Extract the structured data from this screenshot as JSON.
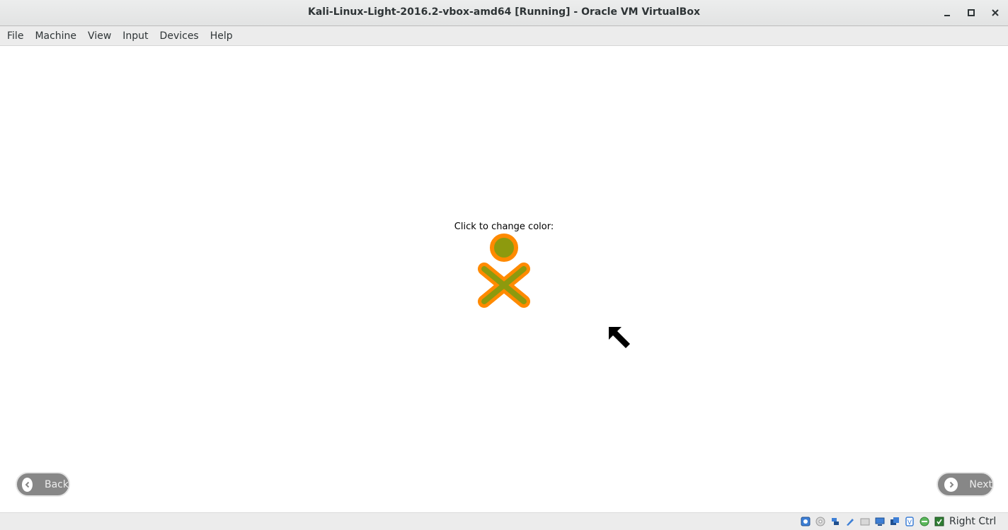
{
  "window": {
    "title": "Kali-Linux-Light-2016.2-vbox-amd64 [Running] - Oracle VM VirtualBox"
  },
  "menu": {
    "items": [
      {
        "label": "File"
      },
      {
        "label": "Machine"
      },
      {
        "label": "View"
      },
      {
        "label": "Input"
      },
      {
        "label": "Devices"
      },
      {
        "label": "Help"
      }
    ]
  },
  "guest": {
    "prompt": "Click to change color:",
    "xo_icon": {
      "fill": "#8d9a0e",
      "stroke": "#ff8a00",
      "icon": "xo-person-icon"
    },
    "back_label": "Back",
    "next_label": "Next"
  },
  "statusbar": {
    "host_key": "Right Ctrl",
    "icons": [
      "hard-disk-icon",
      "optical-drive-icon",
      "usb-icon",
      "shared-folders-icon",
      "display-icon",
      "network-icon",
      "video-capture-icon",
      "mouse-integration-icon",
      "guest-additions-icon",
      "cpu-icon"
    ]
  },
  "colors": {
    "accent_orange": "#ff8a00",
    "accent_green": "#8d9a0e",
    "nav_button": "#878787"
  }
}
